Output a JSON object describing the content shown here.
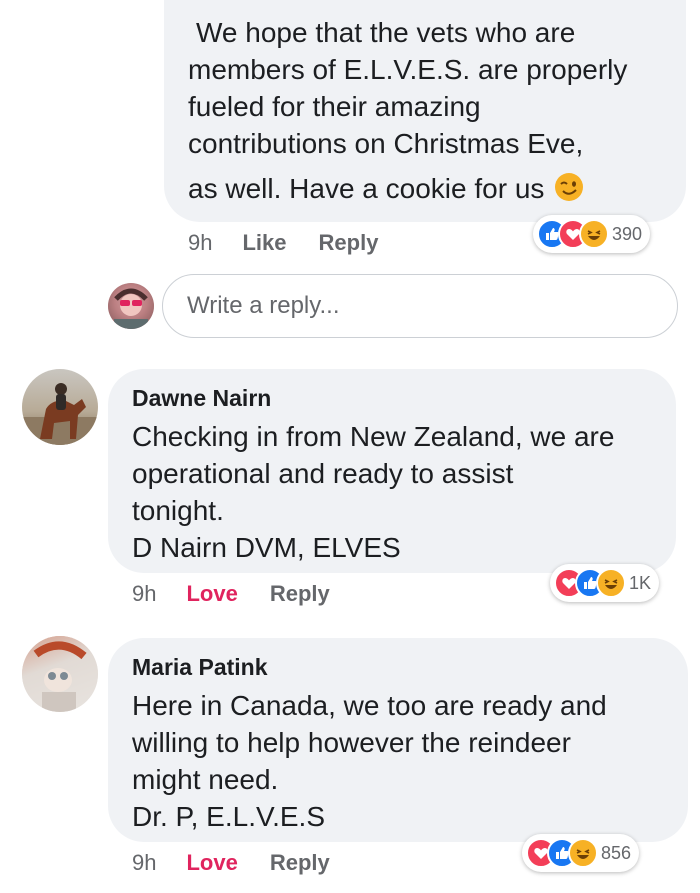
{
  "comment_top": {
    "lines": [
      "We hope that the vets who are",
      "members of E.L.V.E.S. are properly",
      "fueled for their amazing",
      "contributions on Christmas Eve,",
      "as well. Have a cookie for us"
    ],
    "emoji": "wink-emoji",
    "time": "9h",
    "like_label": "Like",
    "reply_label": "Reply",
    "reaction_icons": [
      "like-icon",
      "love-icon",
      "haha-icon"
    ],
    "reaction_count": "390"
  },
  "reply_input": {
    "placeholder": "Write a reply..."
  },
  "comment_dawne": {
    "author": "Dawne Nairn",
    "lines": [
      "Checking in from New Zealand, we are",
      "operational and ready to assist",
      "tonight.",
      "D Nairn DVM, ELVES"
    ],
    "time": "9h",
    "love_label": "Love",
    "reply_label": "Reply",
    "reaction_icons": [
      "love-icon",
      "like-icon",
      "haha-icon"
    ],
    "reaction_count": "1K"
  },
  "comment_maria": {
    "author": "Maria Patink",
    "lines": [
      "Here in Canada, we too are ready and",
      "willing to help however the reindeer",
      "might need.",
      "Dr. P,  E.L.V.E.S"
    ],
    "time": "9h",
    "love_label": "Love",
    "reply_label": "Reply",
    "reaction_icons": [
      "love-icon",
      "like-icon",
      "haha-icon"
    ],
    "reaction_count": "856"
  },
  "colors": {
    "bubble": "#f0f2f5",
    "love_text": "#e0245e",
    "like_blue": "#1877f2",
    "love_red": "#f33e58",
    "haha_yellow": "#f7b125"
  }
}
